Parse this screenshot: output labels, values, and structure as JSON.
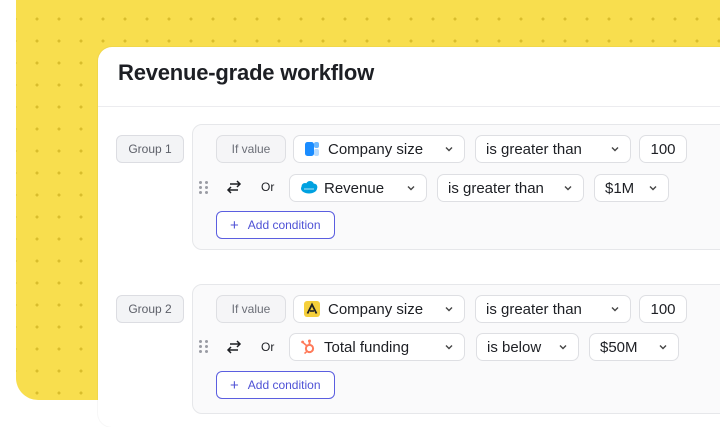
{
  "card": {
    "title": "Revenue-grade workflow"
  },
  "groups": [
    {
      "label": "Group 1",
      "row1": {
        "prefix": "If value",
        "field": {
          "label": "Company size",
          "icon": "clearbit-logo-icon"
        },
        "operator": "is greater than",
        "value": "100"
      },
      "row2": {
        "joiner": "Or",
        "field": {
          "label": "Revenue",
          "icon": "salesforce-logo-icon"
        },
        "operator": "is greater than",
        "value": "$1M"
      },
      "add_label": "Add condition"
    },
    {
      "label": "Group 2",
      "row1": {
        "prefix": "If value",
        "field": {
          "label": "Company size",
          "icon": "apollo-logo-icon"
        },
        "operator": "is greater than",
        "value": "100"
      },
      "row2": {
        "joiner": "Or",
        "field": {
          "label": "Total funding",
          "icon": "hubspot-logo-icon"
        },
        "operator": "is below",
        "value": "$50M"
      },
      "add_label": "Add condition"
    }
  ],
  "colors": {
    "background": "#f8de4e",
    "accent": "#5b5ee0",
    "clearbit": "#1a8cff",
    "salesforce": "#00a1e0",
    "apollo": "#f5cf3b",
    "hubspot": "#ff7a59"
  }
}
